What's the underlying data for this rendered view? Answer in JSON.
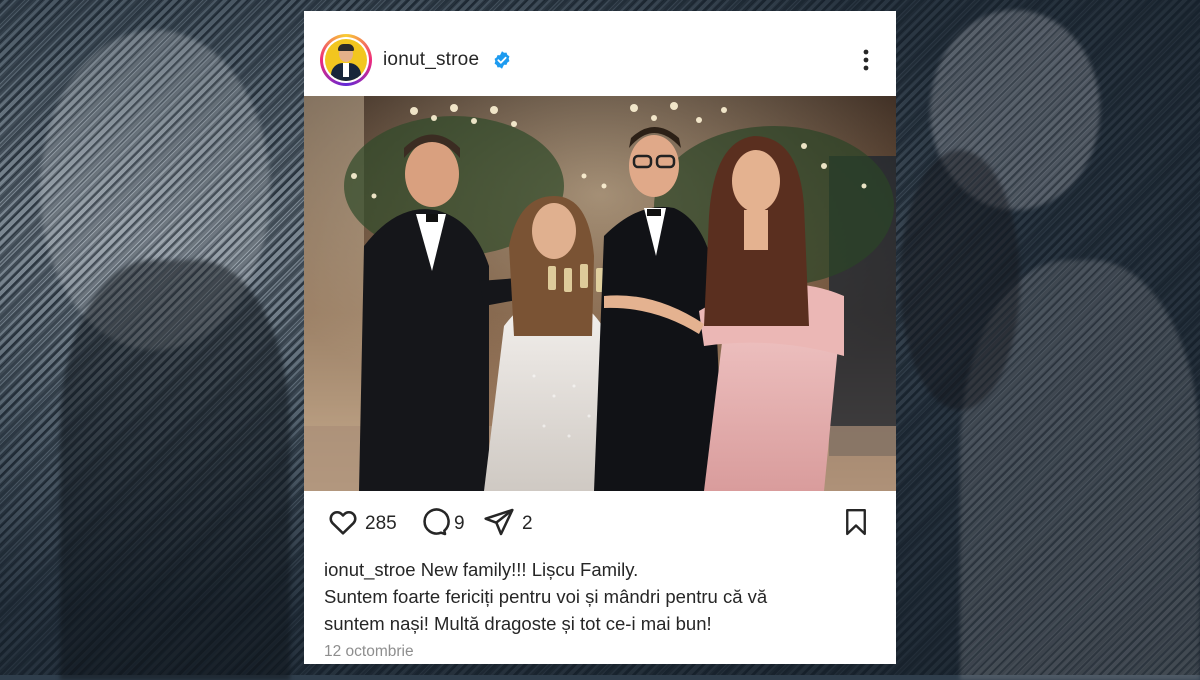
{
  "post": {
    "username": "ionut_stroe",
    "verified": true,
    "avatar_icon": "profile-avatar",
    "more_icon": "more-vertical-icon",
    "photo_alt": "",
    "likes": "285",
    "comments": "9",
    "shares": "2",
    "caption": {
      "username": "ionut_stroe",
      "line1": "New family!!! Lișcu Family.",
      "line2": "Suntem foarte fericiți pentru voi și mândri pentru că vă",
      "line3": "suntem nași! Multă dragoste și tot ce-i mai bun!"
    },
    "date": "12 octombrie"
  },
  "colors": {
    "verified_blue": "#1d9bf0",
    "text": "#262626",
    "muted": "#8e8e8e"
  }
}
